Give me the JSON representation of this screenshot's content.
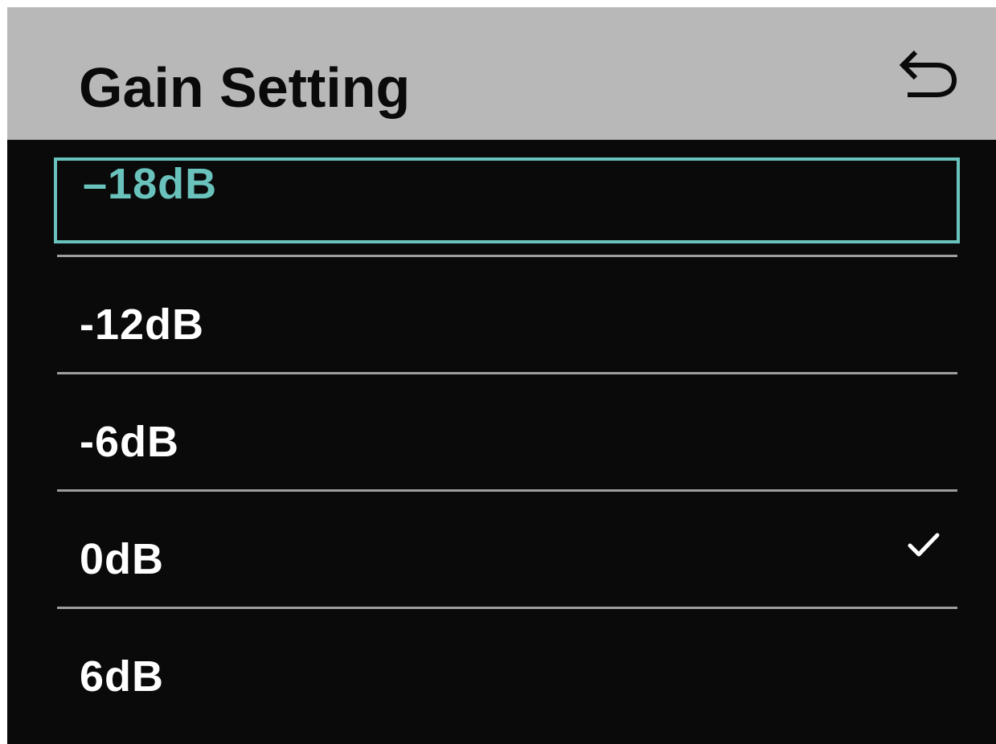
{
  "header": {
    "title": "Gain Setting",
    "back_icon": "back-arrow-icon"
  },
  "options": [
    {
      "label": "–18dB",
      "focused": true,
      "selected": false
    },
    {
      "label": "-12dB",
      "focused": false,
      "selected": false
    },
    {
      "label": "-6dB",
      "focused": false,
      "selected": false
    },
    {
      "label": "0dB",
      "focused": false,
      "selected": true
    },
    {
      "label": "6dB",
      "focused": false,
      "selected": false
    }
  ],
  "colors": {
    "header_bg": "#b8b8b8",
    "screen_bg": "#0a0a0a",
    "accent": "#69c2bb",
    "divider": "#9e9e9e",
    "text": "#ffffff"
  },
  "selected_icon": "checkmark-icon"
}
